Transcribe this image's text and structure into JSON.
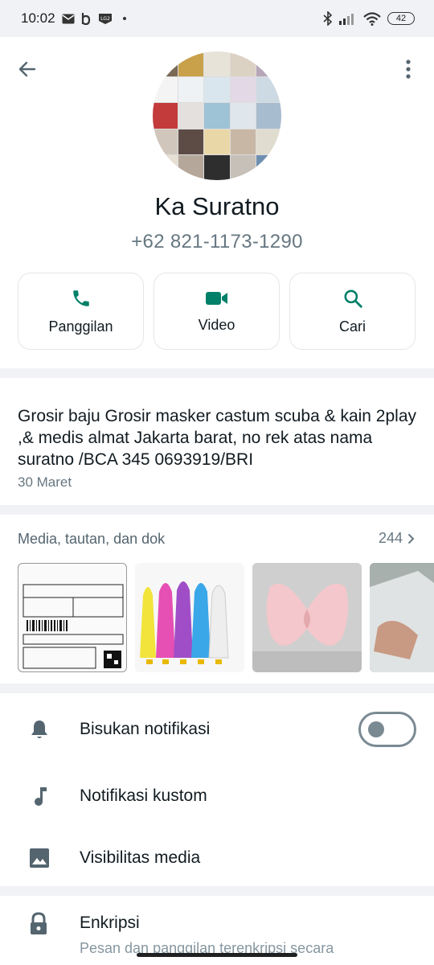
{
  "status_bar": {
    "time": "10:02",
    "battery": "42"
  },
  "contact": {
    "name": "Ka Suratno",
    "phone": "+62 821-1173-1290"
  },
  "actions": [
    {
      "label": "Panggilan",
      "icon": "phone-icon"
    },
    {
      "label": "Video",
      "icon": "video-icon"
    },
    {
      "label": "Cari",
      "icon": "search-icon"
    }
  ],
  "about": {
    "text": "Grosir baju Grosir masker castum scuba & kain 2play ,& medis almat Jakarta barat, no rek atas nama suratno /BCA 345 0693919/BRI",
    "date": "30 Maret"
  },
  "media": {
    "title": "Media, tautan, dan dok",
    "count": "244"
  },
  "settings": [
    {
      "label": "Bisukan notifikasi",
      "icon": "bell-icon",
      "toggle": false
    },
    {
      "label": "Notifikasi kustom",
      "icon": "music-note-icon"
    },
    {
      "label": "Visibilitas media",
      "icon": "image-icon"
    }
  ],
  "encryption": {
    "title": "Enkripsi",
    "subtitle": "Pesan dan panggilan terenkripsi secara"
  },
  "colors": {
    "accent": "#008069",
    "secondary_text": "#667781",
    "background": "#f0f2f5"
  }
}
